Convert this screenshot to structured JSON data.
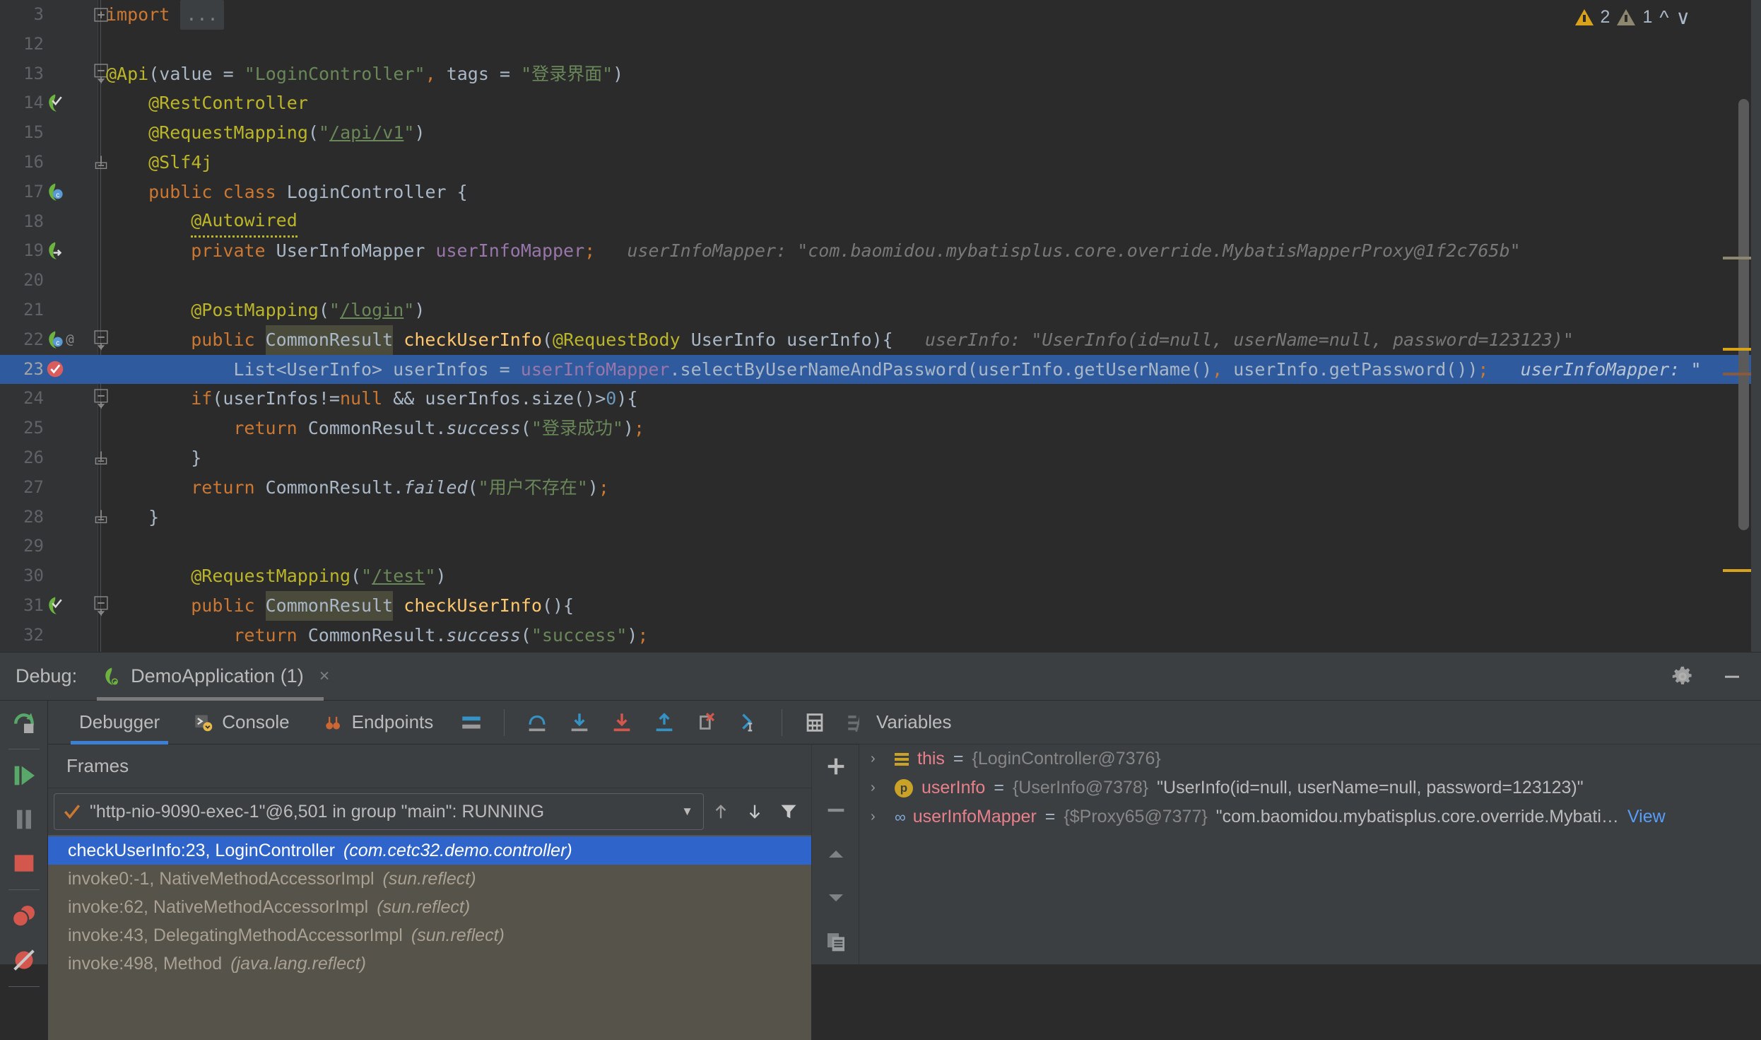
{
  "editor": {
    "inspections": {
      "warn_count": "2",
      "weak_count": "1"
    },
    "lines": [
      {
        "num": "3",
        "indent": 0,
        "fold": "plus",
        "tokens": [
          {
            "t": "import ",
            "c": "kw"
          },
          {
            "t": "...",
            "c": "ellipsis-box"
          }
        ]
      },
      {
        "num": "12",
        "indent": 0,
        "tokens": []
      },
      {
        "num": "13",
        "indent": 0,
        "fold": "start",
        "tokens": [
          {
            "t": "@Api",
            "c": "ann"
          },
          {
            "t": "(",
            "c": "punct"
          },
          {
            "t": "value ",
            "c": "ident"
          },
          {
            "t": "= ",
            "c": "punct"
          },
          {
            "t": "\"LoginController\"",
            "c": "str"
          },
          {
            "t": ", ",
            "c": "semi"
          },
          {
            "t": "tags ",
            "c": "ident"
          },
          {
            "t": "= ",
            "c": "punct"
          },
          {
            "t": "\"登录界面\"",
            "c": "str"
          },
          {
            "t": ")",
            "c": "punct"
          }
        ]
      },
      {
        "num": "14",
        "indent": 1,
        "gutter": "bean-check",
        "tokens": [
          {
            "t": "@RestController",
            "c": "ann"
          }
        ]
      },
      {
        "num": "15",
        "indent": 1,
        "tokens": [
          {
            "t": "@RequestMapping",
            "c": "ann"
          },
          {
            "t": "(",
            "c": "punct"
          },
          {
            "t": "\"",
            "c": "str"
          },
          {
            "t": "/api/v1",
            "c": "url"
          },
          {
            "t": "\"",
            "c": "str"
          },
          {
            "t": ")",
            "c": "punct"
          }
        ]
      },
      {
        "num": "16",
        "indent": 1,
        "fold": "end",
        "tokens": [
          {
            "t": "@Slf4j",
            "c": "ann"
          }
        ]
      },
      {
        "num": "17",
        "indent": 1,
        "gutter": "bean-class",
        "tokens": [
          {
            "t": "public ",
            "c": "kw"
          },
          {
            "t": "class ",
            "c": "kw"
          },
          {
            "t": "LoginController ",
            "c": "cls"
          },
          {
            "t": "{",
            "c": "punct"
          }
        ]
      },
      {
        "num": "18",
        "indent": 2,
        "tokens": [
          {
            "t": "@Autowired",
            "c": "ann squiggle"
          }
        ]
      },
      {
        "num": "19",
        "indent": 2,
        "gutter": "bean-arrow",
        "tokens": [
          {
            "t": "private ",
            "c": "kw"
          },
          {
            "t": "UserInfoMapper ",
            "c": "cls"
          },
          {
            "t": "userInfoMapper",
            "c": "fld"
          },
          {
            "t": ";",
            "c": "semi"
          },
          {
            "t": "   userInfoMapper: \"com.baomidou.mybatisplus.core.override.MybatisMapperProxy@1f2c765b\"",
            "c": "hint"
          }
        ]
      },
      {
        "num": "20",
        "indent": 0,
        "tokens": []
      },
      {
        "num": "21",
        "indent": 2,
        "tokens": [
          {
            "t": "@PostMapping",
            "c": "ann"
          },
          {
            "t": "(",
            "c": "punct"
          },
          {
            "t": "\"",
            "c": "str"
          },
          {
            "t": "/login",
            "c": "url"
          },
          {
            "t": "\"",
            "c": "str"
          },
          {
            "t": ")",
            "c": "punct"
          }
        ]
      },
      {
        "num": "22",
        "indent": 2,
        "gutter": "bean-at",
        "fold": "start",
        "tokens": [
          {
            "t": "public ",
            "c": "kw"
          },
          {
            "t": "CommonResult",
            "c": "cls hl-box"
          },
          {
            "t": " ",
            "c": "punct"
          },
          {
            "t": "checkUserInfo",
            "c": "mth"
          },
          {
            "t": "(",
            "c": "punct"
          },
          {
            "t": "@RequestBody ",
            "c": "ann"
          },
          {
            "t": "UserInfo ",
            "c": "cls"
          },
          {
            "t": "userInfo",
            "c": "ident"
          },
          {
            "t": ")",
            "c": "punct"
          },
          {
            "t": "{",
            "c": "punct"
          },
          {
            "t": "   userInfo: \"UserInfo(id=null, userName=null, password=123123)\"",
            "c": "hint"
          }
        ]
      },
      {
        "num": "23",
        "indent": 3,
        "current": true,
        "gutter": "breakpoint",
        "tokens": [
          {
            "t": "List<UserInfo> userInfos ",
            "c": "ident"
          },
          {
            "t": "= ",
            "c": "punct"
          },
          {
            "t": "userInfoMapper",
            "c": "fld"
          },
          {
            "t": ".selectByUserNameAndPassword",
            "c": "ident"
          },
          {
            "t": "(",
            "c": "punct"
          },
          {
            "t": "userInfo.getUserName",
            "c": "ident"
          },
          {
            "t": "()",
            "c": "punct"
          },
          {
            "t": ", ",
            "c": "semi"
          },
          {
            "t": "userInfo.getPassword",
            "c": "ident"
          },
          {
            "t": "())",
            "c": "punct"
          },
          {
            "t": ";",
            "c": "semi"
          },
          {
            "t": "   userInfoMapper: \"",
            "c": "hint"
          }
        ]
      },
      {
        "num": "24",
        "indent": 2,
        "fold": "start",
        "tokens": [
          {
            "t": "if",
            "c": "kw"
          },
          {
            "t": "(userInfos!=",
            "c": "ident"
          },
          {
            "t": "null",
            "c": "kw"
          },
          {
            "t": " && userInfos.size()>",
            "c": "ident"
          },
          {
            "t": "0",
            "c": "num"
          },
          {
            "t": "){",
            "c": "punct"
          }
        ]
      },
      {
        "num": "25",
        "indent": 3,
        "tokens": [
          {
            "t": "return ",
            "c": "kw"
          },
          {
            "t": "CommonResult.",
            "c": "cls"
          },
          {
            "t": "success",
            "c": "stat"
          },
          {
            "t": "(",
            "c": "punct"
          },
          {
            "t": "\"登录成功\"",
            "c": "str"
          },
          {
            "t": ")",
            "c": "punct"
          },
          {
            "t": ";",
            "c": "semi"
          }
        ]
      },
      {
        "num": "26",
        "indent": 2,
        "fold": "end",
        "tokens": [
          {
            "t": "}",
            "c": "punct"
          }
        ]
      },
      {
        "num": "27",
        "indent": 2,
        "tokens": [
          {
            "t": "return ",
            "c": "kw"
          },
          {
            "t": "CommonResult.",
            "c": "cls"
          },
          {
            "t": "failed",
            "c": "stat"
          },
          {
            "t": "(",
            "c": "punct"
          },
          {
            "t": "\"用户不存在\"",
            "c": "str"
          },
          {
            "t": ")",
            "c": "punct"
          },
          {
            "t": ";",
            "c": "semi"
          }
        ]
      },
      {
        "num": "28",
        "indent": 1,
        "fold": "end",
        "tokens": [
          {
            "t": "}",
            "c": "punct"
          }
        ]
      },
      {
        "num": "29",
        "indent": 0,
        "tokens": []
      },
      {
        "num": "30",
        "indent": 2,
        "tokens": [
          {
            "t": "@RequestMapping",
            "c": "ann"
          },
          {
            "t": "(",
            "c": "punct"
          },
          {
            "t": "\"",
            "c": "str"
          },
          {
            "t": "/test",
            "c": "url"
          },
          {
            "t": "\"",
            "c": "str"
          },
          {
            "t": ")",
            "c": "punct"
          }
        ]
      },
      {
        "num": "31",
        "indent": 2,
        "gutter": "bean-check",
        "fold": "start",
        "tokens": [
          {
            "t": "public ",
            "c": "kw"
          },
          {
            "t": "CommonResult",
            "c": "cls hl-box"
          },
          {
            "t": " ",
            "c": "punct"
          },
          {
            "t": "checkUserInfo",
            "c": "mth"
          },
          {
            "t": "(){",
            "c": "punct"
          }
        ]
      },
      {
        "num": "32",
        "indent": 3,
        "tokens": [
          {
            "t": "return ",
            "c": "kw"
          },
          {
            "t": "CommonResult.",
            "c": "cls"
          },
          {
            "t": "success",
            "c": "stat"
          },
          {
            "t": "(",
            "c": "punct"
          },
          {
            "t": "\"success\"",
            "c": "str"
          },
          {
            "t": ")",
            "c": "punct"
          },
          {
            "t": ";",
            "c": "semi"
          }
        ]
      }
    ]
  },
  "debug": {
    "label": "Debug:",
    "tab_title": "DemoApplication (1)",
    "tab_close": "×",
    "tabs": [
      {
        "label": "Debugger",
        "icon": "none",
        "active": true
      },
      {
        "label": "Console",
        "icon": "console-icon",
        "active": false
      },
      {
        "label": "Endpoints",
        "icon": "endpoints-icon",
        "active": false
      }
    ],
    "toolbar_icons": [
      "show-execution-point-icon",
      "step-over-icon",
      "step-into-icon",
      "force-step-into-icon",
      "step-out-icon",
      "drop-frame-icon",
      "run-to-cursor-icon",
      "evaluate-expression-icon",
      "settings-filter-icon"
    ],
    "rail_icons": [
      "rerun-icon",
      "resume-program-icon",
      "pause-program-icon",
      "stop-icon",
      "view-breakpoints-icon",
      "mute-breakpoints-icon"
    ],
    "header_right_icons": [
      "gear-icon",
      "hide-icon",
      "layout-icon"
    ],
    "frames": {
      "title": "Frames",
      "thread": "\"http-nio-9090-exec-1\"@6,501 in group \"main\": RUNNING",
      "items": [
        {
          "method": "checkUserInfo:23, LoginController",
          "pkg": "(com.cetc32.demo.controller)",
          "selected": true
        },
        {
          "method": "invoke0:-1, NativeMethodAccessorImpl",
          "pkg": "(sun.reflect)",
          "selected": false
        },
        {
          "method": "invoke:62, NativeMethodAccessorImpl",
          "pkg": "(sun.reflect)",
          "selected": false
        },
        {
          "method": "invoke:43, DelegatingMethodAccessorImpl",
          "pkg": "(sun.reflect)",
          "selected": false
        },
        {
          "method": "invoke:498, Method",
          "pkg": "(java.lang.reflect)",
          "selected": false
        }
      ],
      "ctl_icons": [
        "arrow-up-icon",
        "arrow-down-icon",
        "filter-icon"
      ]
    },
    "mid_rail_icons": [
      "plus-icon",
      "minus-icon",
      "move-up-icon",
      "move-down-icon",
      "copy-icon"
    ],
    "variables": {
      "title": "Variables",
      "items": [
        {
          "icon": "field-icon",
          "name": "this",
          "ref": "{LoginController@7376}",
          "value": "",
          "link": ""
        },
        {
          "icon": "param-icon",
          "name": "userInfo",
          "ref": "{UserInfo@7378}",
          "value": "\"UserInfo(id=null, userName=null, password=123123)\"",
          "link": ""
        },
        {
          "icon": "chain-icon",
          "name": "userInfoMapper",
          "ref": "{$Proxy65@7377}",
          "value": "\"com.baomidou.mybatisplus.core.override.Mybati…",
          "link": "View"
        }
      ]
    }
  },
  "colors": {
    "editor_bg": "#2b2b2b",
    "gutter_bg": "#313335",
    "panel_bg": "#3c3f41",
    "current_line": "#2f5b9e",
    "selection_blue": "#2f65ca",
    "frames_bg": "#56534a",
    "accent_blue": "#3d7fd4"
  }
}
